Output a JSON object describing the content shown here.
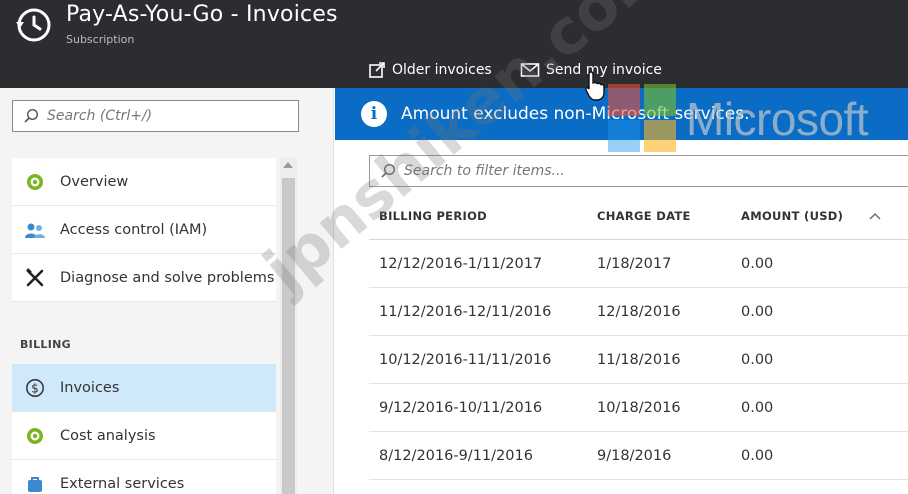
{
  "header": {
    "title": "Pay-As-You-Go - Invoices",
    "subtitle": "Subscription",
    "commands": [
      {
        "label": "Older invoices",
        "icon": "external-link-icon"
      },
      {
        "label": "Send my invoice",
        "icon": "envelope-icon"
      }
    ]
  },
  "sidebar": {
    "search_placeholder": "Search (Ctrl+/)",
    "section_label": "BILLING",
    "items": [
      {
        "label": "Overview",
        "icon": "overview-icon"
      },
      {
        "label": "Access control (IAM)",
        "icon": "users-icon"
      },
      {
        "label": "Diagnose and solve problems",
        "icon": "tools-icon"
      },
      {
        "label": "Invoices",
        "icon": "dollar-icon",
        "active": true
      },
      {
        "label": "Cost analysis",
        "icon": "cost-analysis-icon"
      },
      {
        "label": "External services",
        "icon": "external-services-icon"
      }
    ]
  },
  "main": {
    "banner_text": "Amount excludes non-Microsoft services.",
    "filter_placeholder": "Search to filter items...",
    "table": {
      "headers": [
        "BILLING PERIOD",
        "CHARGE DATE",
        "AMOUNT (USD)"
      ],
      "rows": [
        [
          "12/12/2016-1/11/2017",
          "1/18/2017",
          "0.00"
        ],
        [
          "11/12/2016-12/11/2016",
          "12/18/2016",
          "0.00"
        ],
        [
          "10/12/2016-11/11/2016",
          "11/18/2016",
          "0.00"
        ],
        [
          "9/12/2016-10/11/2016",
          "10/18/2016",
          "0.00"
        ],
        [
          "8/12/2016-9/11/2016",
          "9/18/2016",
          "0.00"
        ]
      ]
    }
  },
  "watermarks": {
    "brand": "Microsoft",
    "site": "jpnshiken.com"
  },
  "colors": {
    "header_bg": "#2b2d31",
    "banner_bg": "#0a6cc4",
    "active_item_bg": "#cfe9fb",
    "icon_green": "#7ab51d"
  }
}
